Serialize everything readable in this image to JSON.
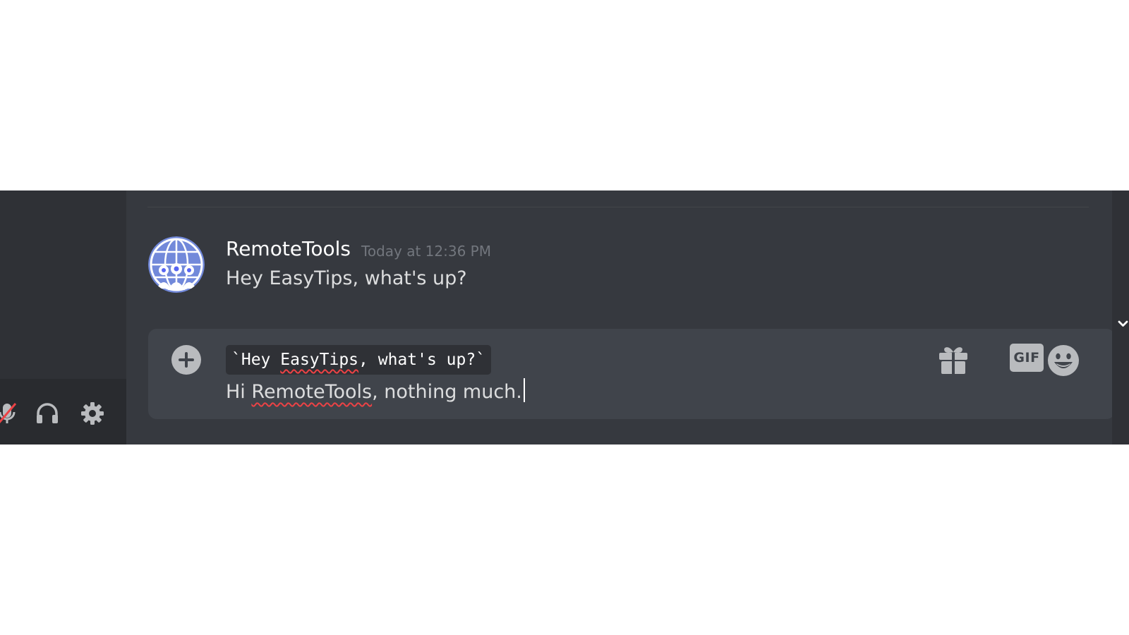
{
  "message": {
    "author": "RemoteTools",
    "timestamp": "Today at 12:36 PM",
    "content": "Hey EasyTips, what's up?",
    "avatar_icon": "globe-people-avatar"
  },
  "composer": {
    "quote_prefix": "`Hey ",
    "quote_misspelled": "EasyTips",
    "quote_suffix": ", what's up?`",
    "typed_prefix": "Hi ",
    "typed_misspelled": "RemoteTools",
    "typed_suffix": ", nothing much.",
    "gif_label": "GIF",
    "icons": {
      "attach": "plus-circle-icon",
      "gift": "gift-icon",
      "gif": "gif-icon",
      "emoji": "emoji-icon"
    }
  },
  "user_panel": {
    "icons": [
      "mute-microphone-icon",
      "headphones-icon",
      "settings-gear-icon"
    ]
  },
  "colors": {
    "chat_background": "#36393f",
    "sidebar_background": "#2f3136",
    "composer_background": "#40444b",
    "spellcheck_underline": "#ed4245",
    "avatar_accent": "#7289da"
  }
}
